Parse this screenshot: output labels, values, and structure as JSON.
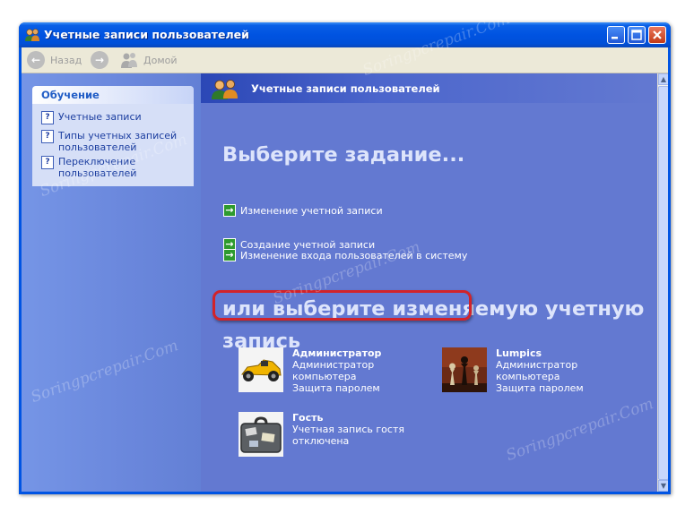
{
  "window": {
    "title": "Учетные записи пользователей",
    "icon": "users-icon",
    "controls": [
      "minimize-icon",
      "maximize-icon",
      "close-icon"
    ]
  },
  "toolbar": {
    "back_label": "Назад",
    "home_label": "Домой"
  },
  "sidebar": {
    "panel_title": "Обучение",
    "links": [
      {
        "label": "Учетные записи",
        "icon": "help-icon"
      },
      {
        "label": "Типы учетных записей пользователей",
        "icon": "help-icon"
      },
      {
        "label": "Переключение пользователей",
        "icon": "help-icon"
      }
    ]
  },
  "main": {
    "header_title": "Учетные записи пользователей",
    "heading_pick_task": "Выберите задание...",
    "tasks": [
      {
        "label": "Изменение учетной записи"
      },
      {
        "label": "Создание учетной записи"
      },
      {
        "label": "Изменение входа пользователей в систему"
      }
    ],
    "heading_pick_account": "или выберите изменяемую учетную запись",
    "heading_pick_account_line1": "или выберите изменяемую учетную",
    "heading_pick_account_line2": "запись",
    "accounts": [
      {
        "name": "Администратор",
        "line1": "Администратор",
        "line2": "компьютера",
        "line3": "Защита паролем",
        "picture": "race-car-picture"
      },
      {
        "name": "Lumpics",
        "line1": "Администратор",
        "line2": "компьютера",
        "line3": "Защита паролем",
        "picture": "chess-picture"
      },
      {
        "name": "Гость",
        "line1": "Учетная запись гостя",
        "line2": "отключена",
        "line3": "",
        "picture": "suitcase-picture"
      }
    ]
  },
  "watermark": "Soringpcrepair.Com",
  "colors": {
    "titlebar": "#0054e3",
    "left_pane": "#7595e6",
    "content_bg": "#6379d1",
    "highlight": "#d2232a",
    "task_arrow": "#2e9a2e"
  }
}
